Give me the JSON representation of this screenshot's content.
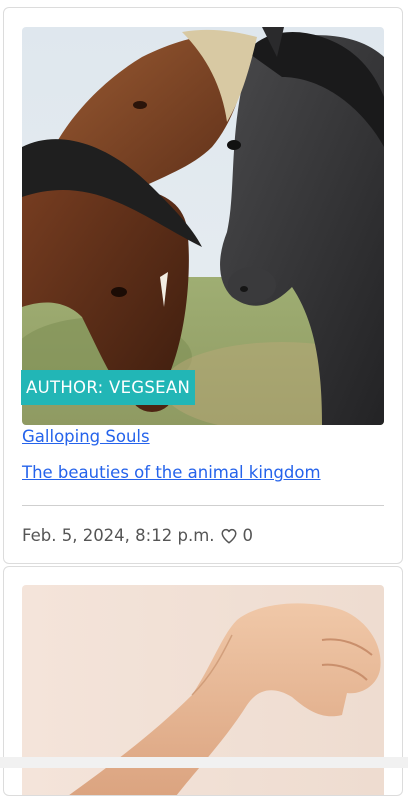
{
  "posts": [
    {
      "author_badge": "AUTHOR: VEGSEAN",
      "title": "Galloping Souls",
      "subtitle": "The beauties of the animal kingdom",
      "date": "Feb. 5, 2024, 8:12 p.m.",
      "likes": "0",
      "image": "horses-photo",
      "like_icon": "heart-icon"
    },
    {
      "image": "arm-photo"
    }
  ],
  "colors": {
    "badge_background": "#22b6b6",
    "link": "#2563eb",
    "meta_text": "#555555"
  }
}
